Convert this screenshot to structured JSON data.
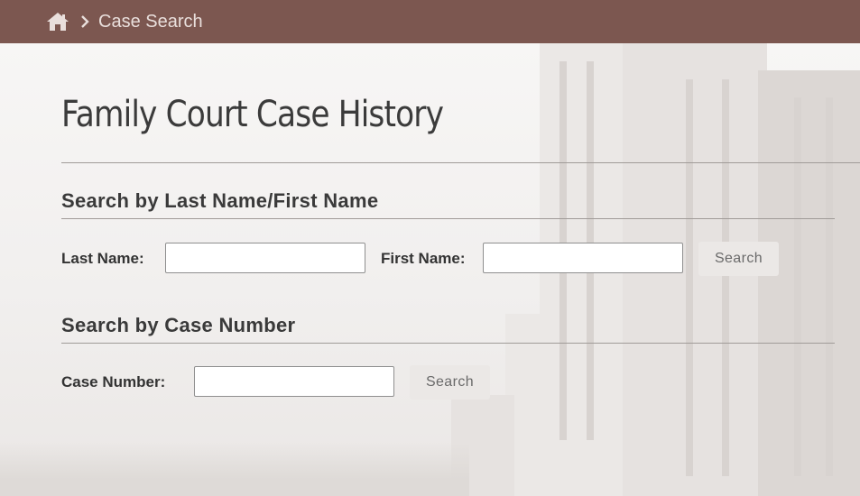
{
  "breadcrumb": {
    "home_icon": "home-icon",
    "separator_icon": "chevron-right-icon",
    "current": "Case Search"
  },
  "page": {
    "title": "Family Court Case History"
  },
  "name_search": {
    "heading": "Search by Last Name/First Name",
    "last_name_label": "Last Name:",
    "last_name_value": "",
    "first_name_label": "First Name:",
    "first_name_value": "",
    "button_label": "Search"
  },
  "case_search": {
    "heading": "Search by Case Number",
    "case_number_label": "Case Number:",
    "case_number_value": "",
    "button_label": "Search"
  },
  "colors": {
    "topbar": "#7c5750",
    "breadcrumb_text": "#e9dfdc",
    "button_bg": "#ebe8e6"
  }
}
